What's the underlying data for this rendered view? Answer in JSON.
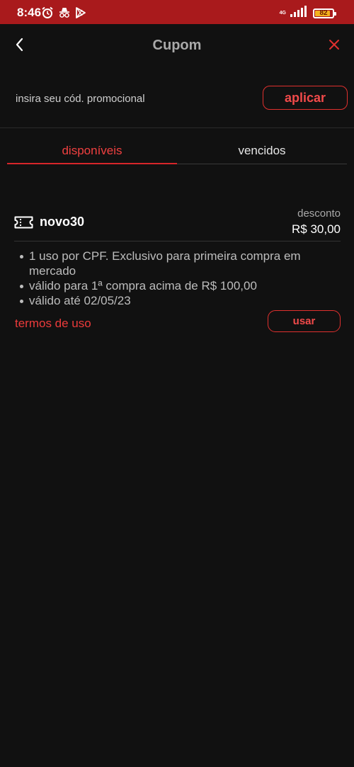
{
  "status_bar": {
    "time": "8:46",
    "network": "4G",
    "battery": "82"
  },
  "header": {
    "title": "Cupom"
  },
  "promo": {
    "placeholder": "insira seu cód. promocional",
    "apply_label": "aplicar"
  },
  "tabs": [
    {
      "label": "disponíveis",
      "active": true
    },
    {
      "label": "vencidos",
      "active": false
    }
  ],
  "coupon": {
    "code": "novo30",
    "discount_label": "desconto",
    "discount_value": "R$ 30,00",
    "rules": [
      "1 uso por CPF. Exclusivo para primeira compra em mercado",
      "válido para 1ª compra acima de R$ 100,00",
      "válido até 02/05/23"
    ],
    "terms_label": "termos de uso",
    "use_label": "usar"
  },
  "colors": {
    "status_bar": "#a91a1c",
    "background": "#111111",
    "accent": "#e0302e"
  }
}
